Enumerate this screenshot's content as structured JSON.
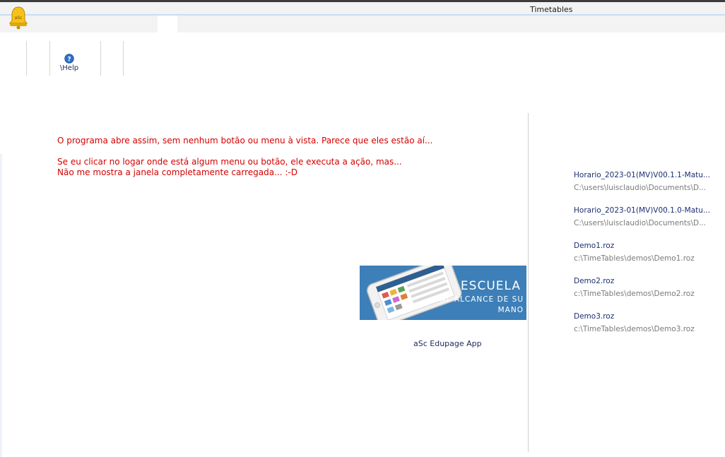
{
  "window": {
    "title": "Timetables"
  },
  "toolbar": {
    "help_label": "\\Help"
  },
  "message": {
    "line1": "O programa abre assim, sem nenhum botão ou menu à vista. Parece que eles estão aí...",
    "line2": "Se eu clicar no logar onde está algum menu ou botão, ele executa a ação, mas...",
    "line3": "Não me mostra a janela completamente carregada... :-D"
  },
  "banner": {
    "title": "ESCUELA",
    "subtitle1": "AL ALCANCE DE SU",
    "subtitle2": "MANO",
    "app_link": "aSc Edupage App"
  },
  "recent_files": [
    {
      "name": "Horario_2023-01(MV)V00.1.1-Matu...",
      "path": "C:\\users\\luisclaudio\\Documents\\D..."
    },
    {
      "name": "Horario_2023-01(MV)V00.1.0-Matu...",
      "path": "C:\\users\\luisclaudio\\Documents\\D..."
    },
    {
      "name": "Demo1.roz",
      "path": "c:\\TimeTables\\demos\\Demo1.roz"
    },
    {
      "name": "Demo2.roz",
      "path": "c:\\TimeTables\\demos\\Demo2.roz"
    },
    {
      "name": "Demo3.roz",
      "path": "c:\\TimeTables\\demos\\Demo3.roz"
    }
  ],
  "icons": {
    "app": "asc-bell-icon",
    "help": "help-question-icon"
  },
  "colors": {
    "message": "#d40000",
    "banner": "#3d7fb8",
    "link": "#1b2f70"
  }
}
